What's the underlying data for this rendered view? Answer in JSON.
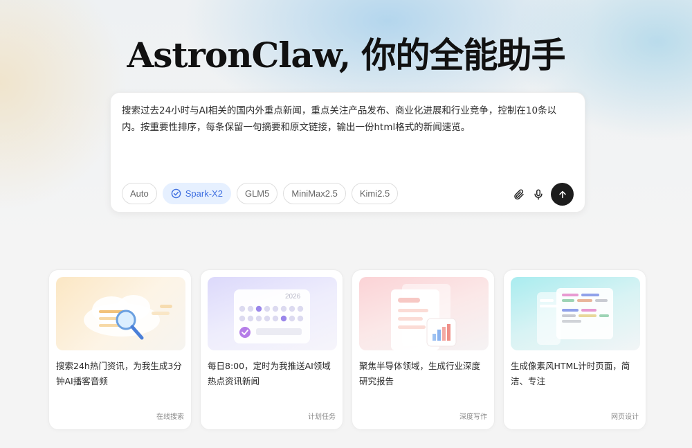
{
  "header": {
    "title": "AstronClaw, 你的全能助手"
  },
  "prompt": {
    "text": "搜索过去24小时与AI相关的国内外重点新闻，重点关注产品发布、商业化进展和行业竞争，控制在10条以内。按重要性排序，每条保留一句摘要和原文链接，输出一份html格式的新闻速览。"
  },
  "models": [
    {
      "label": "Auto",
      "selected": false
    },
    {
      "label": "Spark-X2",
      "selected": true
    },
    {
      "label": "GLM5",
      "selected": false
    },
    {
      "label": "MiniMax2.5",
      "selected": false
    },
    {
      "label": "Kimi2.5",
      "selected": false
    }
  ],
  "tools": {
    "attach_icon": "paperclip-icon",
    "voice_icon": "microphone-icon",
    "send_icon": "arrow-up-icon"
  },
  "cards": [
    {
      "text": "搜索24h热门资讯，为我生成3分钟AI播客音频",
      "tag": "在线搜索",
      "icon": "magnifier-cloud-icon"
    },
    {
      "text": "每日8:00，定时为我推送AI领域热点资讯新闻",
      "tag": "计划任务",
      "icon": "calendar-icon",
      "thumb_year": "2026"
    },
    {
      "text": "聚焦半导体领域，生成行业深度研究报告",
      "tag": "深度写作",
      "icon": "report-chart-icon"
    },
    {
      "text": "生成像素风HTML计时页面，简洁、专注",
      "tag": "网页设计",
      "icon": "code-window-icon"
    }
  ],
  "colors": {
    "accent": "#3f6fe0",
    "send_button": "#1d1d1d",
    "selected_chip_bg": "#e6f0ff"
  }
}
